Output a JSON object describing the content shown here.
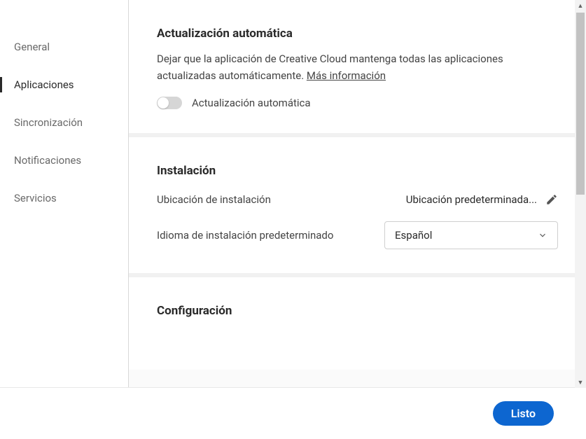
{
  "sidebar": {
    "items": [
      {
        "label": "General",
        "active": false
      },
      {
        "label": "Aplicaciones",
        "active": true
      },
      {
        "label": "Sincronización",
        "active": false
      },
      {
        "label": "Notificaciones",
        "active": false
      },
      {
        "label": "Servicios",
        "active": false
      }
    ]
  },
  "sections": {
    "auto_update": {
      "title": "Actualización automática",
      "description": "Dejar que la aplicación de Creative Cloud mantenga todas las aplicaciones actualizadas automáticamente. ",
      "link_text": "Más información",
      "toggle_label": "Actualización automática",
      "toggle_on": false
    },
    "install": {
      "title": "Instalación",
      "location_label": "Ubicación de instalación",
      "location_value": "Ubicación predeterminada...",
      "language_label": "Idioma de instalación predeterminado",
      "language_value": "Español"
    },
    "config": {
      "title": "Configuración"
    }
  },
  "footer": {
    "done_label": "Listo"
  }
}
